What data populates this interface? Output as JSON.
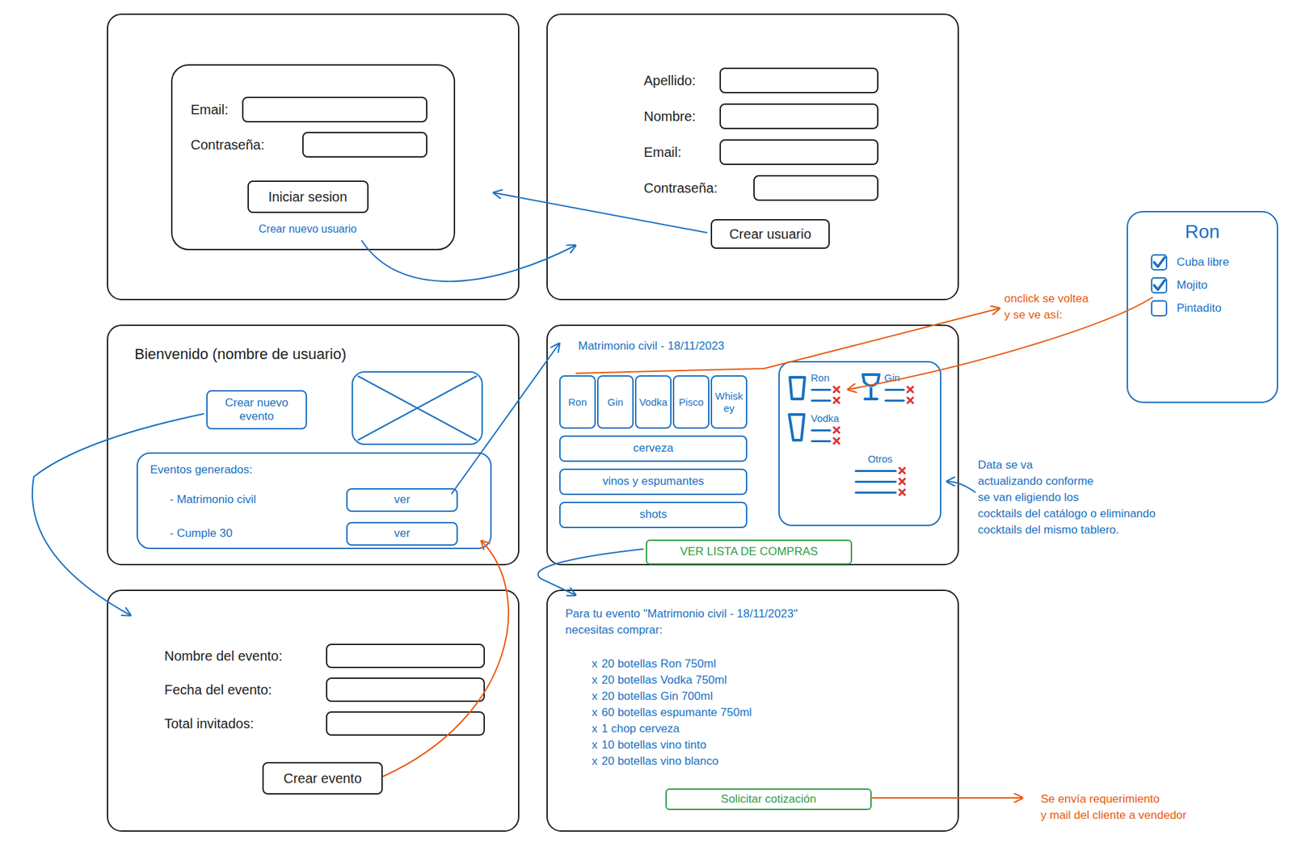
{
  "login": {
    "email_label": "Email:",
    "password_label": "Contraseña:",
    "submit": "Iniciar sesion",
    "register_link": "Crear nuevo usuario"
  },
  "register": {
    "fields": [
      {
        "label": "Apellido:"
      },
      {
        "label": "Nombre:"
      },
      {
        "label": "Email:"
      },
      {
        "label": "Contraseña:"
      }
    ],
    "submit": "Crear usuario"
  },
  "dashboard": {
    "greeting": "Bienvenido (nombre de usuario)",
    "new_event": "Crear nuevo evento",
    "events_title": "Eventos generados:",
    "events": [
      {
        "name": "- Matrimonio civil",
        "action": "ver"
      },
      {
        "name": "- Cumple 30",
        "action": "ver"
      }
    ]
  },
  "event_board": {
    "title": "Matrimonio civil - 18/11/2023",
    "spirits": [
      "Ron",
      "Gin",
      "Vodka",
      "Pisco",
      "Whiskey"
    ],
    "categories": [
      "cerveza",
      "vinos y espumantes",
      "shots"
    ],
    "board": [
      {
        "label": "Ron",
        "kind": "rocks",
        "entries": 2
      },
      {
        "label": "Gin",
        "kind": "goblet",
        "entries": 2
      },
      {
        "label": "Vodka",
        "kind": "highball",
        "entries": 2
      },
      {
        "label": "Otros",
        "kind": "plain",
        "entries": 3
      }
    ],
    "shopping_button": "VER LISTA DE COMPRAS"
  },
  "new_event_form": {
    "fields": [
      {
        "label": "Nombre del evento:"
      },
      {
        "label": "Fecha del evento:"
      },
      {
        "label": "Total invitados:"
      }
    ],
    "submit": "Crear evento"
  },
  "shopping_list": {
    "intro": [
      "Para tu evento \"Matrimonio civil - 18/11/2023\"",
      "necesitas comprar:"
    ],
    "bullet": "x",
    "items": [
      "20 botellas Ron 750ml",
      "20 botellas Vodka 750ml",
      "20 botellas Gin 700ml",
      "60 botellas espumante 750ml",
      "1 chop cerveza",
      "10 botellas vino tinto",
      "20 botellas vino blanco"
    ],
    "submit": "Solicitar cotización"
  },
  "cocktail_card": {
    "title": "Ron",
    "options": [
      {
        "label": "Cuba libre",
        "checked": true
      },
      {
        "label": "Mojito",
        "checked": true
      },
      {
        "label": "Pintadito",
        "checked": false
      }
    ]
  },
  "notes": {
    "flip": [
      "onclick se voltea",
      "y se ve así:"
    ],
    "data_update": [
      "Data se va",
      "actualizando conforme",
      "se van eligiendo los",
      "cocktails del catálogo o eliminando",
      "cocktails del mismo tablero."
    ],
    "quote": [
      "Se envía requerimiento",
      "y mail del cliente a vendedor"
    ]
  },
  "arrows": [
    {
      "color": "#1971c2"
    },
    {
      "color": "#1971c2"
    },
    {
      "color": "#1971c2"
    },
    {
      "color": "#1971c2"
    },
    {
      "color": "#e8590c"
    },
    {
      "color": "#1971c2"
    },
    {
      "color": "#e8590c"
    },
    {
      "color": "#e8590c"
    },
    {
      "color": "#1971c2"
    },
    {
      "color": "#e8590c"
    }
  ]
}
